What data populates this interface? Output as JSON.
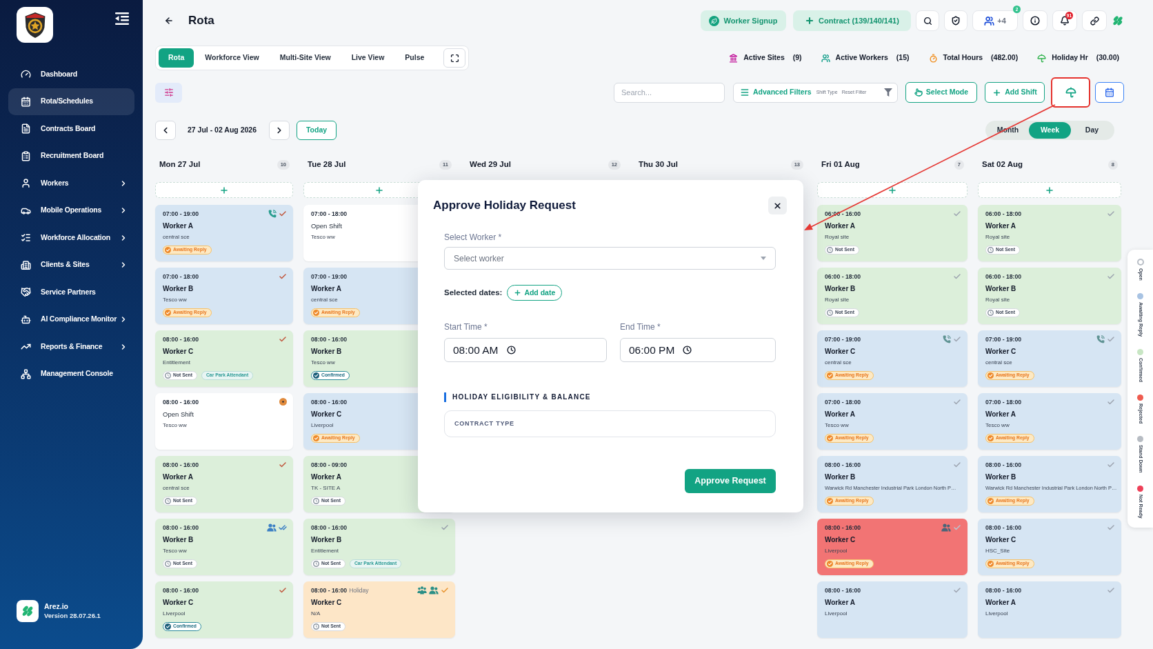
{
  "sidebar": {
    "items": [
      {
        "label": "Dashboard",
        "selected": false,
        "expandable": false
      },
      {
        "label": "Rota/Schedules",
        "selected": true,
        "expandable": false
      },
      {
        "label": "Contracts Board",
        "selected": false,
        "expandable": false
      },
      {
        "label": "Recruitment Board",
        "selected": false,
        "expandable": false
      },
      {
        "label": "Workers",
        "selected": false,
        "expandable": true
      },
      {
        "label": "Mobile Operations",
        "selected": false,
        "expandable": true
      },
      {
        "label": "Workforce Allocation",
        "selected": false,
        "expandable": true
      },
      {
        "label": "Clients & Sites",
        "selected": false,
        "expandable": true
      },
      {
        "label": "Service Partners",
        "selected": false,
        "expandable": false
      },
      {
        "label": "AI Compliance Monitor",
        "selected": false,
        "expandable": true
      },
      {
        "label": "Reports & Finance",
        "selected": false,
        "expandable": true
      },
      {
        "label": "Management Console",
        "selected": false,
        "expandable": false
      }
    ],
    "footer": {
      "brand": "Arez.io",
      "version": "Version 28.07.26.1"
    }
  },
  "header": {
    "title": "Rota",
    "signup": "Worker Signup",
    "contract": "Contract (139/140/141)",
    "team_extra": "+4",
    "team_badge": "2",
    "alerts_badge": "91"
  },
  "tabs": [
    {
      "label": "Rota",
      "selected": true
    },
    {
      "label": "Workforce View",
      "selected": false
    },
    {
      "label": "Multi-Site View",
      "selected": false
    },
    {
      "label": "Live View",
      "selected": false
    },
    {
      "label": "Pulse",
      "selected": false
    }
  ],
  "stats": [
    {
      "label": "Active Sites",
      "value": "(9)"
    },
    {
      "label": "Active Workers",
      "value": "(15)"
    },
    {
      "label": "Total Hours",
      "value": "(482.00)"
    },
    {
      "label": "Holiday Hr",
      "value": "(30.00)"
    }
  ],
  "toolbar": {
    "search_placeholder": "Search...",
    "advanced_filters": "Advanced Filters",
    "filter_hints": [
      "Shift Type",
      "Reset Filter"
    ],
    "select_mode": "Select Mode",
    "add_shift": "Add Shift",
    "holiday_highlighted": true
  },
  "date_nav": {
    "range": "27 Jul - 02 Aug 2026",
    "today": "Today"
  },
  "view_modes": [
    {
      "label": "Month",
      "selected": false
    },
    {
      "label": "Week",
      "selected": true
    },
    {
      "label": "Day",
      "selected": false
    }
  ],
  "days": [
    {
      "label": "Mon 27 Jul",
      "count": "10",
      "can_add": true,
      "cards": [
        {
          "kind": "shift",
          "color": "#d6e5f3",
          "time": "07:00 - 19:00",
          "name": "Worker A",
          "site": "central sce",
          "status": {
            "kind": "awaiting",
            "label": "Awaiting Reply"
          },
          "indicators": [
            {
              "kind": "phone",
              "color": "#2a9d8f"
            },
            {
              "kind": "check",
              "color": "#c0563c"
            }
          ]
        },
        {
          "kind": "shift",
          "color": "#d6e5f3",
          "time": "07:00 - 18:00",
          "name": "Worker B",
          "site": "Tesco ww",
          "status": {
            "kind": "awaiting",
            "label": "Awaiting Reply"
          },
          "indicators": [
            {
              "kind": "check",
              "color": "#c0563c"
            }
          ]
        },
        {
          "kind": "shift",
          "color": "#dcefda",
          "time": "08:00 - 16:00",
          "name": "Worker C",
          "site": "Entitlement",
          "status": {
            "kind": "not_sent",
            "label": "Not Sent"
          },
          "tag": "Car Park Attendant",
          "indicators": [
            {
              "kind": "check",
              "color": "#c0563c"
            }
          ]
        },
        {
          "kind": "open",
          "color": "#ffffff",
          "time": "08:00 - 16:00",
          "name": "Open Shift",
          "site": "Tesco ww",
          "indicators": [
            {
              "kind": "dot",
              "color": "#e08a3c"
            }
          ]
        },
        {
          "kind": "shift",
          "color": "#dcefda",
          "time": "08:00 - 16:00",
          "name": "Worker A",
          "site": "central sce",
          "status": {
            "kind": "not_sent",
            "label": "Not Sent"
          },
          "indicators": [
            {
              "kind": "check",
              "color": "#c0563c"
            }
          ]
        },
        {
          "kind": "shift",
          "color": "#dcefda",
          "time": "08:00 - 16:00",
          "name": "Worker B",
          "site": "Tesco ww",
          "status": {
            "kind": "not_sent",
            "label": "Not Sent"
          },
          "indicators": [
            {
              "kind": "users",
              "color": "#3b7fc4"
            },
            {
              "kind": "double_check",
              "color": "#3b7fc4"
            }
          ]
        },
        {
          "kind": "shift",
          "color": "#dcefda",
          "time": "08:00 - 16:00",
          "name": "Worker C",
          "site": "Liverpool",
          "status": {
            "kind": "confirmed",
            "label": "Confirmed"
          },
          "indicators": [
            {
              "kind": "check",
              "color": "#c0563c"
            }
          ]
        }
      ]
    },
    {
      "label": "Tue 28 Jul",
      "count": "11",
      "can_add": true,
      "cards": [
        {
          "kind": "open",
          "color": "#ffffff",
          "time": "07:00 - 18:00",
          "name": "Open Shift",
          "site": "Tesco ww"
        },
        {
          "kind": "shift",
          "color": "#d6e5f3",
          "time": "07:00 - 19:00",
          "name": "Worker A",
          "site": "central sce",
          "status": {
            "kind": "awaiting",
            "label": "Awaiting Reply"
          }
        },
        {
          "kind": "shift",
          "color": "#dcefda",
          "time": "08:00 - 16:00",
          "name": "Worker B",
          "site": "Tesco ww",
          "status": {
            "kind": "confirmed",
            "label": "Confirmed"
          }
        },
        {
          "kind": "shift",
          "color": "#d6e5f3",
          "time": "08:00 - 16:00",
          "name": "Worker C",
          "site": "Liverpool",
          "status": {
            "kind": "awaiting",
            "label": "Awaiting Reply"
          }
        },
        {
          "kind": "shift",
          "color": "#dcefda",
          "time": "08:00 - 09:00",
          "name": "Worker A",
          "site": "TK - SITE A",
          "status": {
            "kind": "not_sent",
            "label": "Not Sent"
          }
        },
        {
          "kind": "shift",
          "color": "#dcefda",
          "time": "08:00 - 16:00",
          "name": "Worker B",
          "site": "Entitlement",
          "status": {
            "kind": "not_sent",
            "label": "Not Sent"
          },
          "tag": "Car Park Attendant",
          "indicators": [
            {
              "kind": "check",
              "color": "#9ca3af"
            }
          ]
        },
        {
          "kind": "shift",
          "color": "#fde6c7",
          "time": "08:00 - 16:00",
          "note": "Holiday",
          "name": "Worker C",
          "site": "N/A",
          "status": {
            "kind": "not_sent",
            "label": "Not Sent"
          },
          "indicators": [
            {
              "kind": "group",
              "color": "#2a8f86"
            },
            {
              "kind": "users",
              "color": "#2a8f86"
            },
            {
              "kind": "check",
              "color": "#e8922c"
            }
          ]
        }
      ]
    },
    {
      "label": "Wed 29 Jul",
      "count": "12",
      "can_add": false
    },
    {
      "label": "Thu 30 Jul",
      "count": "13",
      "can_add": false
    },
    {
      "label": "Fri 01 Aug",
      "count": "7",
      "can_add": true,
      "cards": [
        {
          "kind": "shift",
          "color": "#dcefda",
          "time": "06:00 - 16:00",
          "name": "Worker A",
          "site": "Royal site",
          "status": {
            "kind": "not_sent",
            "label": "Not Sent"
          },
          "indicators": [
            {
              "kind": "check",
              "color": "#9ca3af"
            }
          ]
        },
        {
          "kind": "shift",
          "color": "#dcefda",
          "time": "06:00 - 18:00",
          "name": "Worker B",
          "site": "Royal site",
          "status": {
            "kind": "not_sent",
            "label": "Not Sent"
          },
          "indicators": [
            {
              "kind": "check",
              "color": "#9ca3af"
            }
          ]
        },
        {
          "kind": "shift",
          "color": "#d6e5f3",
          "time": "07:00 - 19:00",
          "name": "Worker C",
          "site": "central sce",
          "status": {
            "kind": "awaiting",
            "label": "Awaiting Reply"
          },
          "indicators": [
            {
              "kind": "phone",
              "color": "#5f9393"
            },
            {
              "kind": "check",
              "color": "#9ca3af"
            }
          ]
        },
        {
          "kind": "shift",
          "color": "#d6e5f3",
          "time": "07:00 - 18:00",
          "name": "Worker A",
          "site": "Tesco ww",
          "status": {
            "kind": "awaiting",
            "label": "Awaiting Reply"
          },
          "indicators": [
            {
              "kind": "check",
              "color": "#9ca3af"
            }
          ]
        },
        {
          "kind": "shift",
          "color": "#d6e5f3",
          "time": "08:00 - 16:00",
          "name": "Worker B",
          "site": "Warwick Rd Manchester Industrial Park London North P…",
          "status": {
            "kind": "awaiting",
            "label": "Awaiting Reply"
          },
          "indicators": [
            {
              "kind": "check",
              "color": "#9ca3af"
            }
          ]
        },
        {
          "kind": "shift",
          "color": "#f27474",
          "time": "08:00 - 16:00",
          "name": "Worker C",
          "site": "Liverpool",
          "status": {
            "kind": "awaiting",
            "label": "Awaiting Reply"
          },
          "indicators": [
            {
              "kind": "users",
              "color": "#4b6478"
            },
            {
              "kind": "check",
              "color": "#b8c6d2"
            }
          ]
        },
        {
          "kind": "shift",
          "color": "#d6e5f3",
          "time": "08:00 - 16:00",
          "name": "Worker A",
          "site": "Liverpool",
          "indicators": [
            {
              "kind": "check",
              "color": "#9ca3af"
            }
          ]
        }
      ]
    },
    {
      "label": "Sat 02 Aug",
      "count": "8",
      "can_add": true,
      "cards": [
        {
          "kind": "shift",
          "color": "#dcefda",
          "time": "06:00 - 18:00",
          "name": "Worker A",
          "site": "Royal site",
          "status": {
            "kind": "not_sent",
            "label": "Not Sent"
          },
          "indicators": [
            {
              "kind": "check",
              "color": "#9ca3af"
            }
          ]
        },
        {
          "kind": "shift",
          "color": "#dcefda",
          "time": "06:00 - 18:00",
          "name": "Worker B",
          "site": "Royal site",
          "status": {
            "kind": "not_sent",
            "label": "Not Sent"
          },
          "indicators": [
            {
              "kind": "check",
              "color": "#9ca3af"
            }
          ]
        },
        {
          "kind": "shift",
          "color": "#d6e5f3",
          "time": "07:00 - 19:00",
          "name": "Worker C",
          "site": "central sce",
          "status": {
            "kind": "awaiting",
            "label": "Awaiting Reply"
          },
          "indicators": [
            {
              "kind": "phone",
              "color": "#5f9393"
            },
            {
              "kind": "check",
              "color": "#9ca3af"
            }
          ]
        },
        {
          "kind": "shift",
          "color": "#d6e5f3",
          "time": "07:00 - 18:00",
          "name": "Worker A",
          "site": "Tesco ww",
          "status": {
            "kind": "awaiting",
            "label": "Awaiting Reply"
          },
          "indicators": [
            {
              "kind": "check",
              "color": "#9ca3af"
            }
          ]
        },
        {
          "kind": "shift",
          "color": "#d6e5f3",
          "time": "08:00 - 16:00",
          "name": "Worker B",
          "site": "Warwick Rd Manchester Industrial Park London North P…",
          "status": {
            "kind": "awaiting",
            "label": "Awaiting Reply"
          },
          "indicators": [
            {
              "kind": "check",
              "color": "#9ca3af"
            }
          ]
        },
        {
          "kind": "shift",
          "color": "#d6e5f3",
          "time": "08:00 - 16:00",
          "name": "Worker C",
          "site": "HSC_Site",
          "status": {
            "kind": "awaiting",
            "label": "Awaiting Reply"
          },
          "indicators": [
            {
              "kind": "check",
              "color": "#9ca3af"
            }
          ]
        },
        {
          "kind": "shift",
          "color": "#d6e5f3",
          "time": "08:00 - 16:00",
          "name": "Worker A",
          "site": "Liverpool",
          "indicators": [
            {
              "kind": "check",
              "color": "#9ca3af"
            }
          ]
        }
      ]
    }
  ],
  "modal": {
    "title": "Approve Holiday Request",
    "worker_label": "Select Worker *",
    "worker_placeholder": "Select worker",
    "dates_label": "Selected dates:",
    "add_date": "Add date",
    "start_label": "Start Time *",
    "start_value": "08:00 AM",
    "end_label": "End Time *",
    "end_value": "06:00 PM",
    "section": "HOLIDAY ELIGIBILITY & BALANCE",
    "contract_type": "CONTRACT TYPE",
    "submit": "Approve Request"
  },
  "legend": [
    {
      "label": "Open",
      "kind": "ring",
      "color": "#b8bec6"
    },
    {
      "label": "Awaiting Reply",
      "kind": "dot",
      "color": "#a8c3e3"
    },
    {
      "label": "Confirmed",
      "kind": "dot",
      "color": "#c8e6c4"
    },
    {
      "label": "Rejected",
      "kind": "dot",
      "color": "#ef5b4f"
    },
    {
      "label": "Stand Down",
      "kind": "dot",
      "color": "#b7bcc3"
    },
    {
      "label": "Not Ready",
      "kind": "dot",
      "color": "#ee4058"
    }
  ]
}
